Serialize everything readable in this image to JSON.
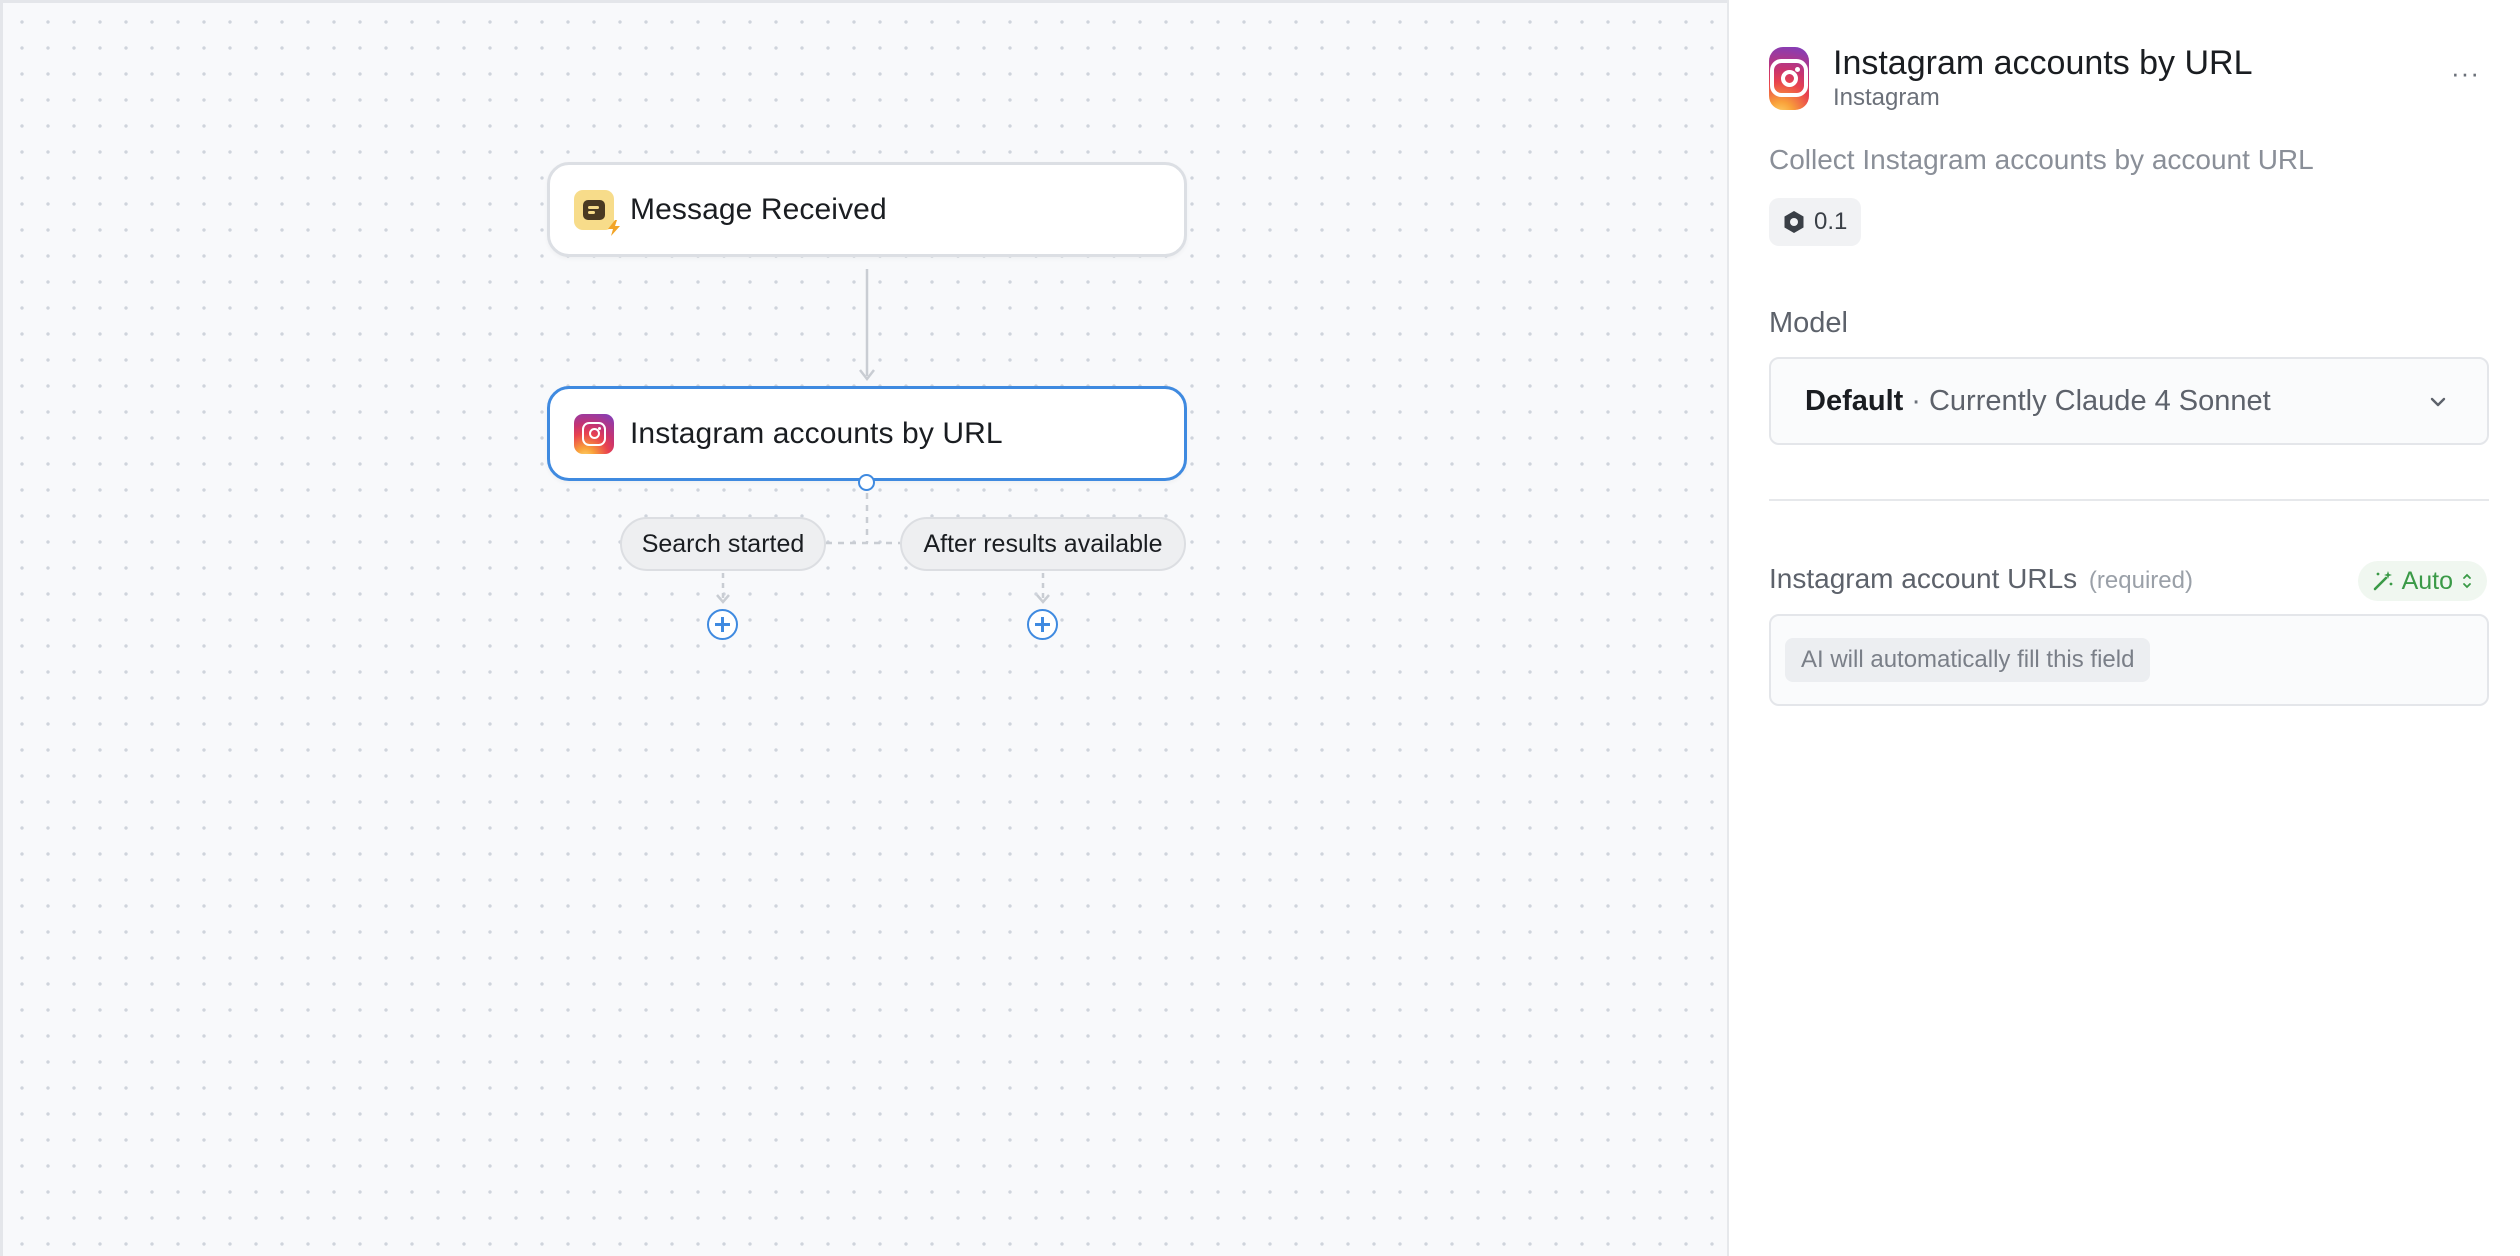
{
  "canvas": {
    "trigger_node": {
      "title": "Message Received",
      "icon": "message-bolt-icon"
    },
    "action_node": {
      "title": "Instagram accounts by URL",
      "icon": "instagram-icon"
    },
    "branches": [
      {
        "label": "Search started"
      },
      {
        "label": "After results available"
      }
    ]
  },
  "panel": {
    "title": "Instagram accounts by URL",
    "subtitle": "Instagram",
    "more_label": "···",
    "description": "Collect Instagram accounts by account URL",
    "version": "0.1",
    "model": {
      "label": "Model",
      "selected_name": "Default",
      "separator": "·",
      "selected_detail": "Currently Claude 4 Sonnet"
    },
    "field": {
      "label": "Instagram account URLs",
      "required_text": "(required)",
      "mode": "Auto",
      "placeholder": "AI will automatically fill this field"
    }
  },
  "colors": {
    "accent_blue": "#3f8ae0",
    "auto_green": "#3a9a47",
    "canvas_bg": "#f8f9fb"
  }
}
